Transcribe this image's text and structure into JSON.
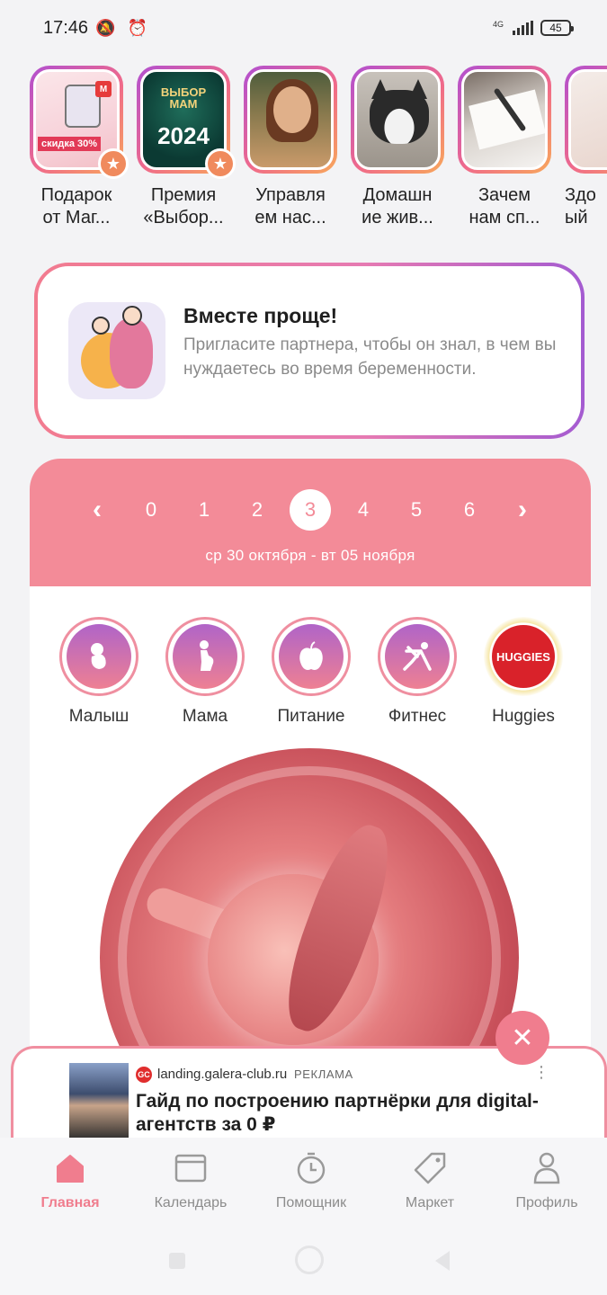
{
  "status_bar": {
    "time": "17:46",
    "left_icons": "🔕 ⏰",
    "network": "4G",
    "battery": "45"
  },
  "stories": [
    {
      "line1": "Подарок",
      "line2": "от Маг...",
      "thumb_text": "скидка 30%",
      "badge": "★"
    },
    {
      "line1": "Премия",
      "line2": "«Выбор...",
      "thumb_text": "2024",
      "badge": "★"
    },
    {
      "line1": "Управля",
      "line2": "ем нас..."
    },
    {
      "line1": "Домашн",
      "line2": "ие жив..."
    },
    {
      "line1": "Зачем",
      "line2": "нам сп..."
    },
    {
      "line1": "Здо",
      "line2": "ый"
    }
  ],
  "invite": {
    "title": "Вместе проще!",
    "text": "Пригласите партнера, чтобы он знал, в чем вы нуждаетесь во время беременности."
  },
  "week": {
    "numbers": [
      "0",
      "1",
      "2",
      "3",
      "4",
      "5",
      "6"
    ],
    "active": "3",
    "prev": "‹",
    "next": "›",
    "range": "ср 30 октября - вт 05 ноября"
  },
  "categories": [
    {
      "label": "Малыш",
      "icon": "baby-icon"
    },
    {
      "label": "Мама",
      "icon": "pregnant-icon"
    },
    {
      "label": "Питание",
      "icon": "apple-icon"
    },
    {
      "label": "Фитнес",
      "icon": "fitness-icon"
    },
    {
      "label": "Huggies",
      "icon": "huggies-logo",
      "logo_text": "HUGGIES"
    }
  ],
  "ad": {
    "close": "✕",
    "badge": "GC",
    "domain": "landing.galera-club.ru",
    "label": "РЕКЛАМА",
    "more": "⋮",
    "title": "Гайд по построению партнёрки для digital-агентств за 0 ₽"
  },
  "nav": {
    "items": [
      {
        "label": "Главная",
        "icon": "home-icon",
        "active": true
      },
      {
        "label": "Календарь",
        "icon": "calendar-icon"
      },
      {
        "label": "Помощник",
        "icon": "timer-icon"
      },
      {
        "label": "Маркет",
        "icon": "tag-icon"
      },
      {
        "label": "Профиль",
        "icon": "profile-icon"
      }
    ]
  },
  "colors": {
    "accent": "#f07d8e",
    "week_header": "#f38b98",
    "text_muted": "#8a8a8a"
  }
}
